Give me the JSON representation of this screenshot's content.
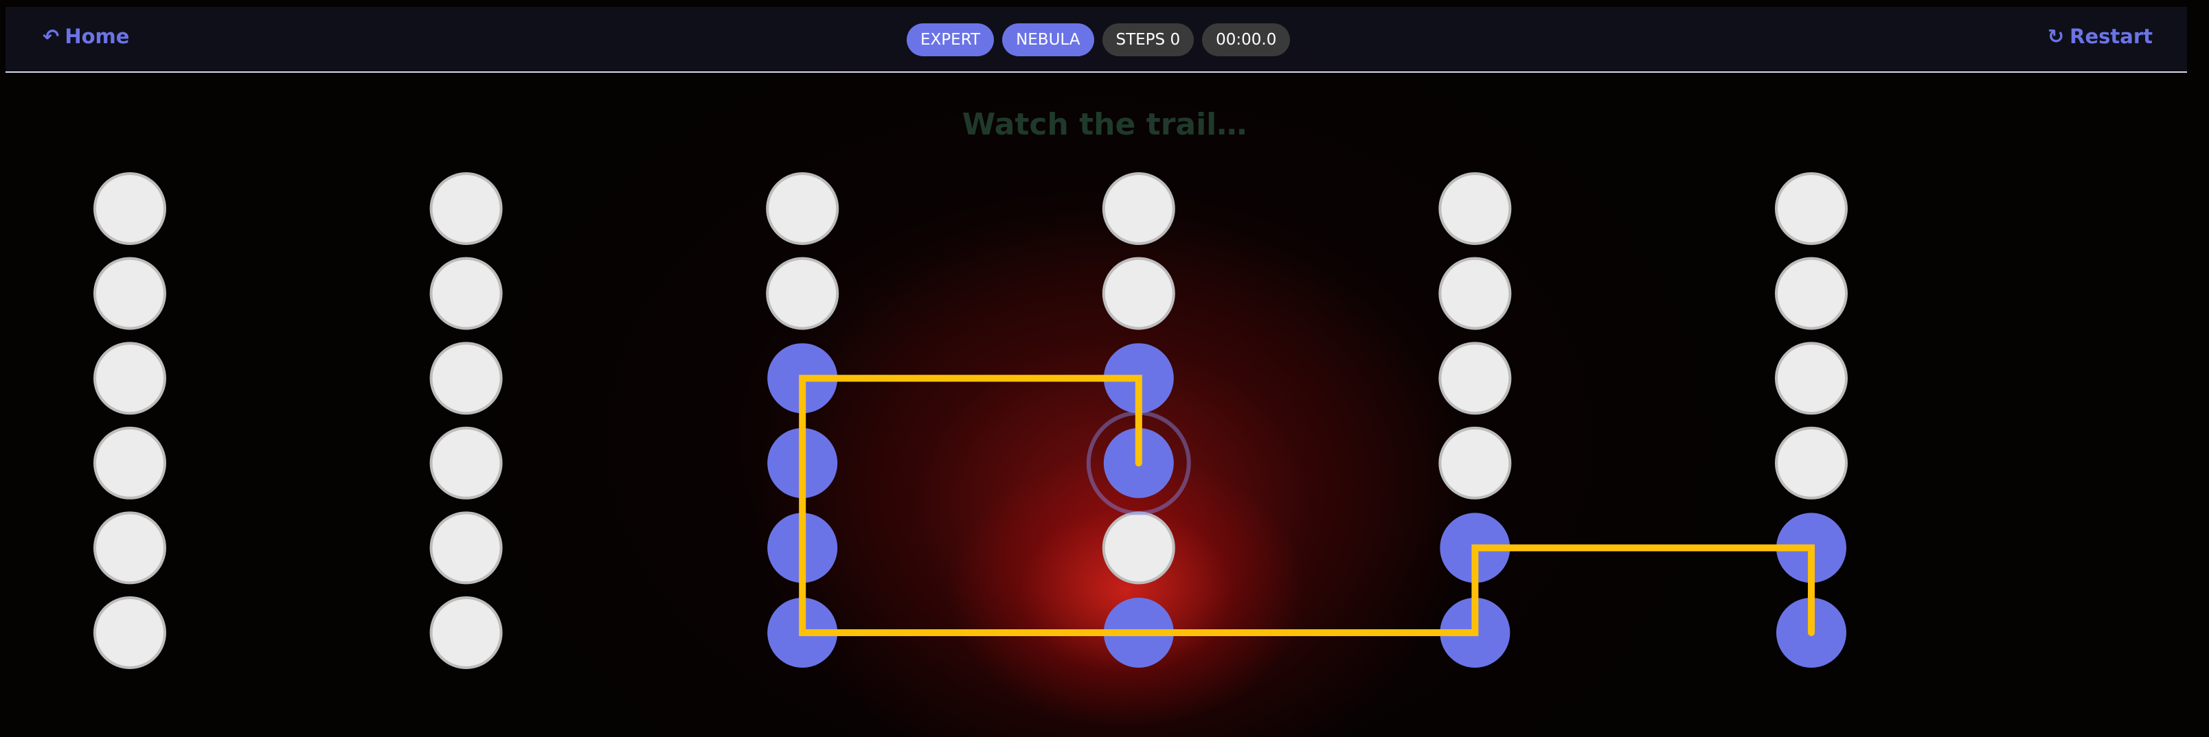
{
  "nav": {
    "home_icon": "↶",
    "home_label": "Home",
    "restart_icon": "↻",
    "restart_label": "Restart"
  },
  "chips": {
    "difficulty": "EXPERT",
    "theme": "NEBULA",
    "steps": "STEPS 0",
    "timer": "00:00.0"
  },
  "status_text": "Watch the trail…",
  "colors": {
    "accent": "#6b74e6",
    "trail": "#ffc107",
    "dot_off": "#ececec",
    "dot_on": "#6b74e6"
  },
  "grid": {
    "columns": 6,
    "rows": 6,
    "lit_cells": [
      [
        2,
        2
      ],
      [
        2,
        3
      ],
      [
        2,
        4
      ],
      [
        2,
        5
      ],
      [
        3,
        2
      ],
      [
        3,
        3
      ],
      [
        3,
        5
      ],
      [
        4,
        4
      ],
      [
        4,
        5
      ],
      [
        5,
        4
      ],
      [
        5,
        5
      ]
    ],
    "current_cell": [
      3,
      3
    ],
    "trail_cells": [
      [
        3,
        3
      ],
      [
        3,
        2
      ],
      [
        2,
        2
      ],
      [
        2,
        5
      ],
      [
        4,
        5
      ],
      [
        4,
        4
      ],
      [
        5,
        4
      ],
      [
        5,
        5
      ]
    ]
  }
}
